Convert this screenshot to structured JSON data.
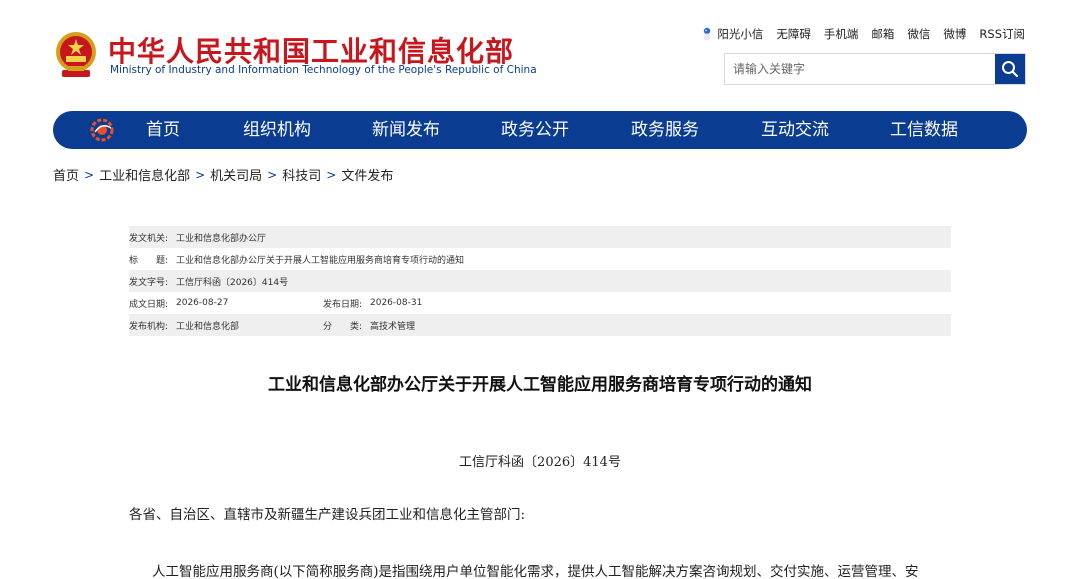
{
  "header": {
    "title_cn": "中华人民共和国工业和信息化部",
    "title_en": "Ministry of Industry and Information Technology of the People's Republic of China",
    "emblem_icon": "national-emblem-icon"
  },
  "toplinks": {
    "items": [
      "阳光小信",
      "无障碍",
      "手机端",
      "邮箱",
      "微信",
      "微博",
      "RSS订阅"
    ]
  },
  "search": {
    "placeholder": "请输入关键字",
    "value": ""
  },
  "nav": {
    "items": [
      "首页",
      "组织机构",
      "新闻发布",
      "政务公开",
      "政务服务",
      "互动交流",
      "工信数据"
    ]
  },
  "breadcrumb": {
    "items": [
      "首页",
      "工业和信息化部",
      "机关司局",
      "科技司",
      "文件发布"
    ],
    "separator": ">"
  },
  "info": {
    "issuer_label": "发文机关:",
    "issuer_value": "工业和信息化部办公厅",
    "title_label": "标　　题:",
    "title_value": "工业和信息化部办公厅关于开展人工智能应用服务商培育专项行动的通知",
    "docno_label": "发文字号:",
    "docno_value": "工信厅科函〔2026〕414号",
    "created_label": "成文日期:",
    "created_value": "2026-08-27",
    "published_label": "发布日期:",
    "published_value": "2026-08-31",
    "org_label": "发布机构:",
    "org_value": "工业和信息化部",
    "category_label": "分　　类:",
    "category_value": "高技术管理"
  },
  "article": {
    "title": "工业和信息化部办公厅关于开展人工智能应用服务商培育专项行动的通知",
    "doc_no": "工信厅科函〔2026〕414号",
    "addressee": "各省、自治区、直辖市及新疆生产建设兵团工业和信息化主管部门:",
    "para1": "人工智能应用服务商(以下简称服务商)是指围绕用户单位智能化需求，提供人工智能解决方案咨询规划、交付实施、运营管理、安"
  },
  "colors": {
    "brand_red": "#c8161d",
    "brand_blue": "#0a3d91",
    "row_shade": "#efefef"
  }
}
